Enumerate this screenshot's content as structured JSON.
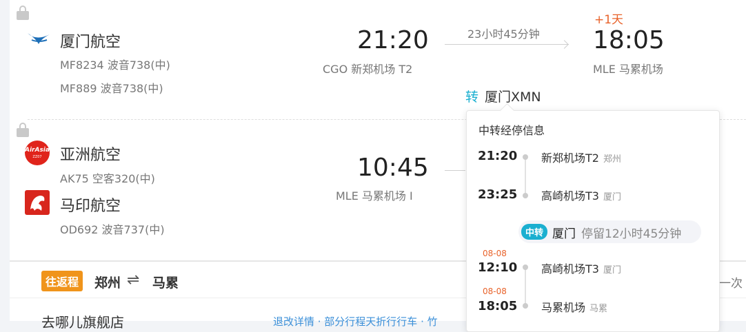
{
  "flight1": {
    "airline": "厦门航空",
    "legs": [
      "MF8234 波音738(中)",
      "MF889 波音738(中)"
    ],
    "dep_time": "21:20",
    "dep_airport": "CGO 新郑机场 T2",
    "duration": "23小时45分钟",
    "day_offset": "+1天",
    "arr_time": "18:05",
    "arr_airport": "MLE 马累机场",
    "transfer_prefix": "转",
    "transfer_city": "厦门XMN"
  },
  "flight2": {
    "airline1": "亚洲航空",
    "leg1": "AK75 空客320(中)",
    "airline2": "马印航空",
    "leg2": "OD692 波音737(中)",
    "dep_time": "10:45",
    "dep_airport": "MLE 马累机场 I",
    "airasia_logo": "AirAsia",
    "airasia_sub": "ZZ07"
  },
  "popup": {
    "title": "中转经停信息",
    "stops": [
      {
        "date": "",
        "time": "21:20",
        "name": "新郑机场T2",
        "city": "郑州"
      },
      {
        "date": "",
        "time": "23:25",
        "name": "高崎机场T3",
        "city": "厦门"
      },
      {
        "date": "08-08",
        "time": "12:10",
        "name": "高崎机场T3",
        "city": "厦门"
      },
      {
        "date": "08-08",
        "time": "18:05",
        "name": "马累机场",
        "city": "马累"
      }
    ],
    "transfer_badge": "中转",
    "transfer_city": "厦门",
    "transfer_stay": "停留12小时45分钟"
  },
  "bottom": {
    "tag": "往返程",
    "from": "郑州",
    "arrow": "⇌",
    "to": "马累",
    "right_text": "一次",
    "partial_left": "去哪儿旗舰店",
    "partial_mid": "退改详情 · 部分行程天折行行车 · 竹"
  },
  "colors": {
    "accent": "#1aafd0",
    "orange": "#f0941b",
    "day_offset": "#e8622a"
  }
}
